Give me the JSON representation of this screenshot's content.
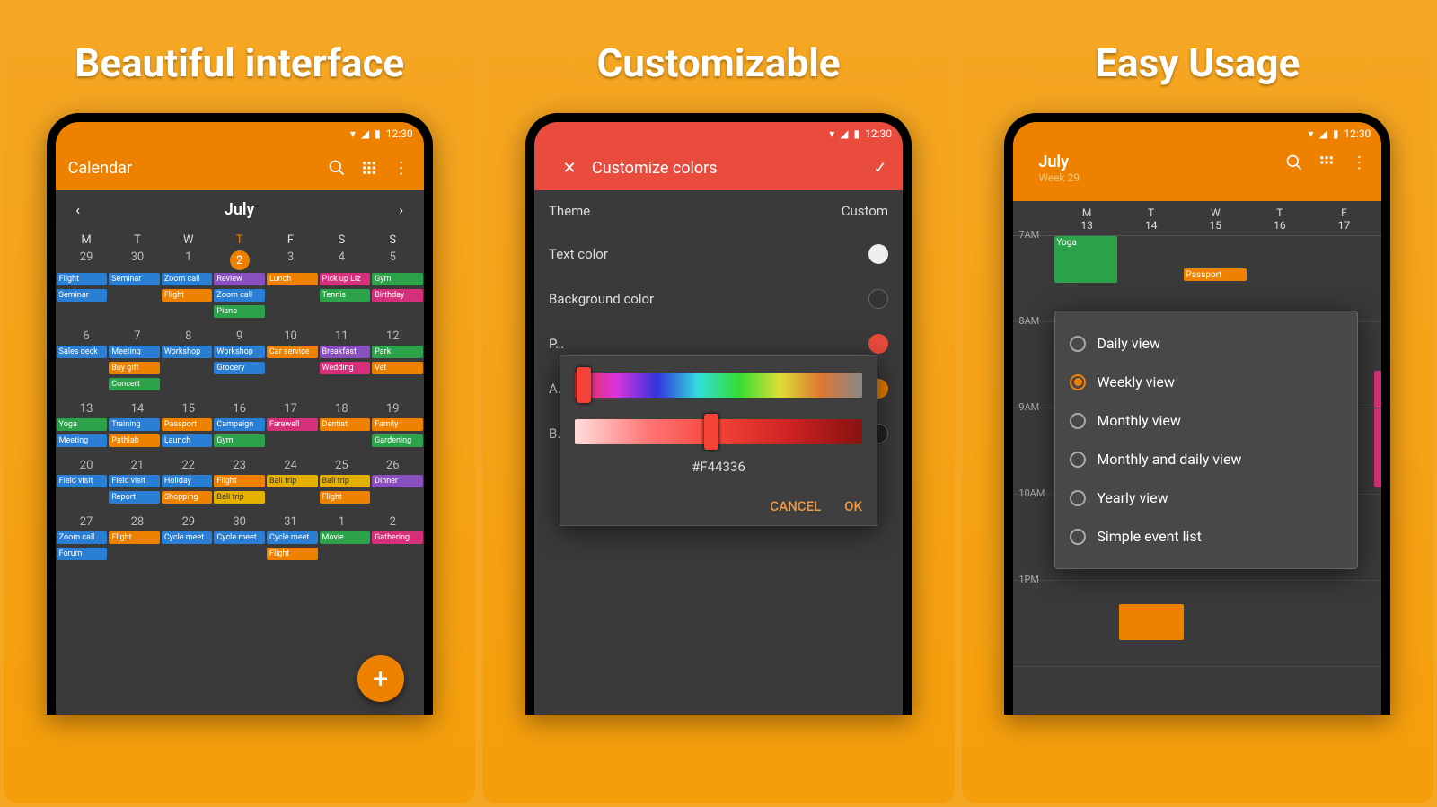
{
  "status_time": "12:30",
  "panel1": {
    "title": "Beautiful interface",
    "app_title": "Calendar",
    "month": "July",
    "dow": [
      "M",
      "T",
      "W",
      "T",
      "F",
      "S",
      "S"
    ],
    "weeks": [
      {
        "dates": [
          "29",
          "30",
          "1",
          "2",
          "3",
          "4",
          "5"
        ],
        "today_index": 3,
        "events": [
          [
            {
              "t": "Flight",
              "c": "blue"
            },
            {
              "t": "Seminar",
              "c": "blue"
            }
          ],
          [
            {
              "t": "Seminar",
              "c": "blue"
            }
          ],
          [
            {
              "t": "Zoom call",
              "c": "blue"
            },
            {
              "t": "Flight",
              "c": "orange"
            }
          ],
          [
            {
              "t": "Review",
              "c": "purple"
            },
            {
              "t": "Zoom call",
              "c": "blue"
            },
            {
              "t": "Piano",
              "c": "green"
            }
          ],
          [
            {
              "t": "Lunch",
              "c": "orange"
            }
          ],
          [
            {
              "t": "Pick up Liz",
              "c": "pink"
            },
            {
              "t": "Tennis",
              "c": "green"
            }
          ],
          [
            {
              "t": "Gym",
              "c": "green"
            },
            {
              "t": "Birthday",
              "c": "pink"
            }
          ]
        ]
      },
      {
        "dates": [
          "6",
          "7",
          "8",
          "9",
          "10",
          "11",
          "12"
        ],
        "events": [
          [
            {
              "t": "Sales deck",
              "c": "blue"
            }
          ],
          [
            {
              "t": "Meeting",
              "c": "blue"
            },
            {
              "t": "Buy gift",
              "c": "orange"
            },
            {
              "t": "Concert",
              "c": "green"
            }
          ],
          [
            {
              "t": "Workshop",
              "c": "blue"
            }
          ],
          [
            {
              "t": "Workshop",
              "c": "blue"
            },
            {
              "t": "Grocery",
              "c": "blue"
            }
          ],
          [
            {
              "t": "Car service",
              "c": "orange"
            }
          ],
          [
            {
              "t": "Breakfast",
              "c": "purple"
            },
            {
              "t": "Wedding",
              "c": "pink"
            }
          ],
          [
            {
              "t": "Park",
              "c": "green"
            },
            {
              "t": "Vet",
              "c": "orange"
            }
          ]
        ]
      },
      {
        "dates": [
          "13",
          "14",
          "15",
          "16",
          "17",
          "18",
          "19"
        ],
        "events": [
          [
            {
              "t": "Yoga",
              "c": "green"
            },
            {
              "t": "Meeting",
              "c": "blue"
            }
          ],
          [
            {
              "t": "Training",
              "c": "blue"
            },
            {
              "t": "Pathlab",
              "c": "orange"
            }
          ],
          [
            {
              "t": "Passport",
              "c": "orange"
            },
            {
              "t": "Launch",
              "c": "blue"
            }
          ],
          [
            {
              "t": "Campaign",
              "c": "blue"
            },
            {
              "t": "Gym",
              "c": "green"
            }
          ],
          [
            {
              "t": "Farewell",
              "c": "pink"
            }
          ],
          [
            {
              "t": "Dentist",
              "c": "orange"
            }
          ],
          [
            {
              "t": "Family",
              "c": "orange"
            },
            {
              "t": "Gardening",
              "c": "green"
            }
          ]
        ]
      },
      {
        "dates": [
          "20",
          "21",
          "22",
          "23",
          "24",
          "25",
          "26"
        ],
        "events": [
          [
            {
              "t": "Field visit",
              "c": "blue"
            }
          ],
          [
            {
              "t": "Field visit",
              "c": "blue"
            },
            {
              "t": "Report",
              "c": "blue"
            }
          ],
          [
            {
              "t": "Holiday",
              "c": "blue"
            },
            {
              "t": "Shopping",
              "c": "orange"
            }
          ],
          [
            {
              "t": "Flight",
              "c": "orange"
            },
            {
              "t": "Bali trip",
              "c": "yellow"
            }
          ],
          [
            {
              "t": "Bali trip",
              "c": "yellow"
            }
          ],
          [
            {
              "t": "Bali trip",
              "c": "yellow"
            },
            {
              "t": "Flight",
              "c": "orange"
            }
          ],
          [
            {
              "t": "Dinner",
              "c": "purple"
            }
          ]
        ]
      },
      {
        "dates": [
          "27",
          "28",
          "29",
          "30",
          "31",
          "1",
          "2"
        ],
        "events": [
          [
            {
              "t": "Zoom call",
              "c": "blue"
            },
            {
              "t": "Forum",
              "c": "blue"
            }
          ],
          [
            {
              "t": "Flight",
              "c": "orange"
            }
          ],
          [
            {
              "t": "Cycle meet",
              "c": "blue"
            }
          ],
          [
            {
              "t": "Cycle meet",
              "c": "blue"
            }
          ],
          [
            {
              "t": "Cycle meet",
              "c": "blue"
            },
            {
              "t": "Flight",
              "c": "orange"
            }
          ],
          [
            {
              "t": "Movie",
              "c": "green"
            }
          ],
          [
            {
              "t": "Gathering",
              "c": "pink"
            }
          ]
        ]
      }
    ]
  },
  "panel2": {
    "title": "Customizable",
    "screen_title": "Customize colors",
    "rows": {
      "theme_label": "Theme",
      "theme_value": "Custom",
      "text_label": "Text color",
      "bg_label": "Background color",
      "primary_label": "Primary color",
      "app_icon_label": "App icon color",
      "bottom_label": "Bottom navigation bar color"
    },
    "hex": "#F44336",
    "cancel": "CANCEL",
    "ok": "OK"
  },
  "panel3": {
    "title": "Easy Usage",
    "month": "July",
    "week": "Week 29",
    "days": [
      {
        "l": "M",
        "d": "13"
      },
      {
        "l": "T",
        "d": "14"
      },
      {
        "l": "W",
        "d": "15"
      },
      {
        "l": "T",
        "d": "16"
      },
      {
        "l": "F",
        "d": "17"
      }
    ],
    "hours": [
      "7AM",
      "8AM",
      "9AM",
      "10AM",
      "1PM"
    ],
    "events": {
      "yoga": "Yoga",
      "passport": "Passport"
    },
    "menu": [
      {
        "label": "Daily view",
        "sel": false
      },
      {
        "label": "Weekly view",
        "sel": true
      },
      {
        "label": "Monthly view",
        "sel": false
      },
      {
        "label": "Monthly and daily view",
        "sel": false
      },
      {
        "label": "Yearly view",
        "sel": false
      },
      {
        "label": "Simple event list",
        "sel": false
      }
    ]
  }
}
